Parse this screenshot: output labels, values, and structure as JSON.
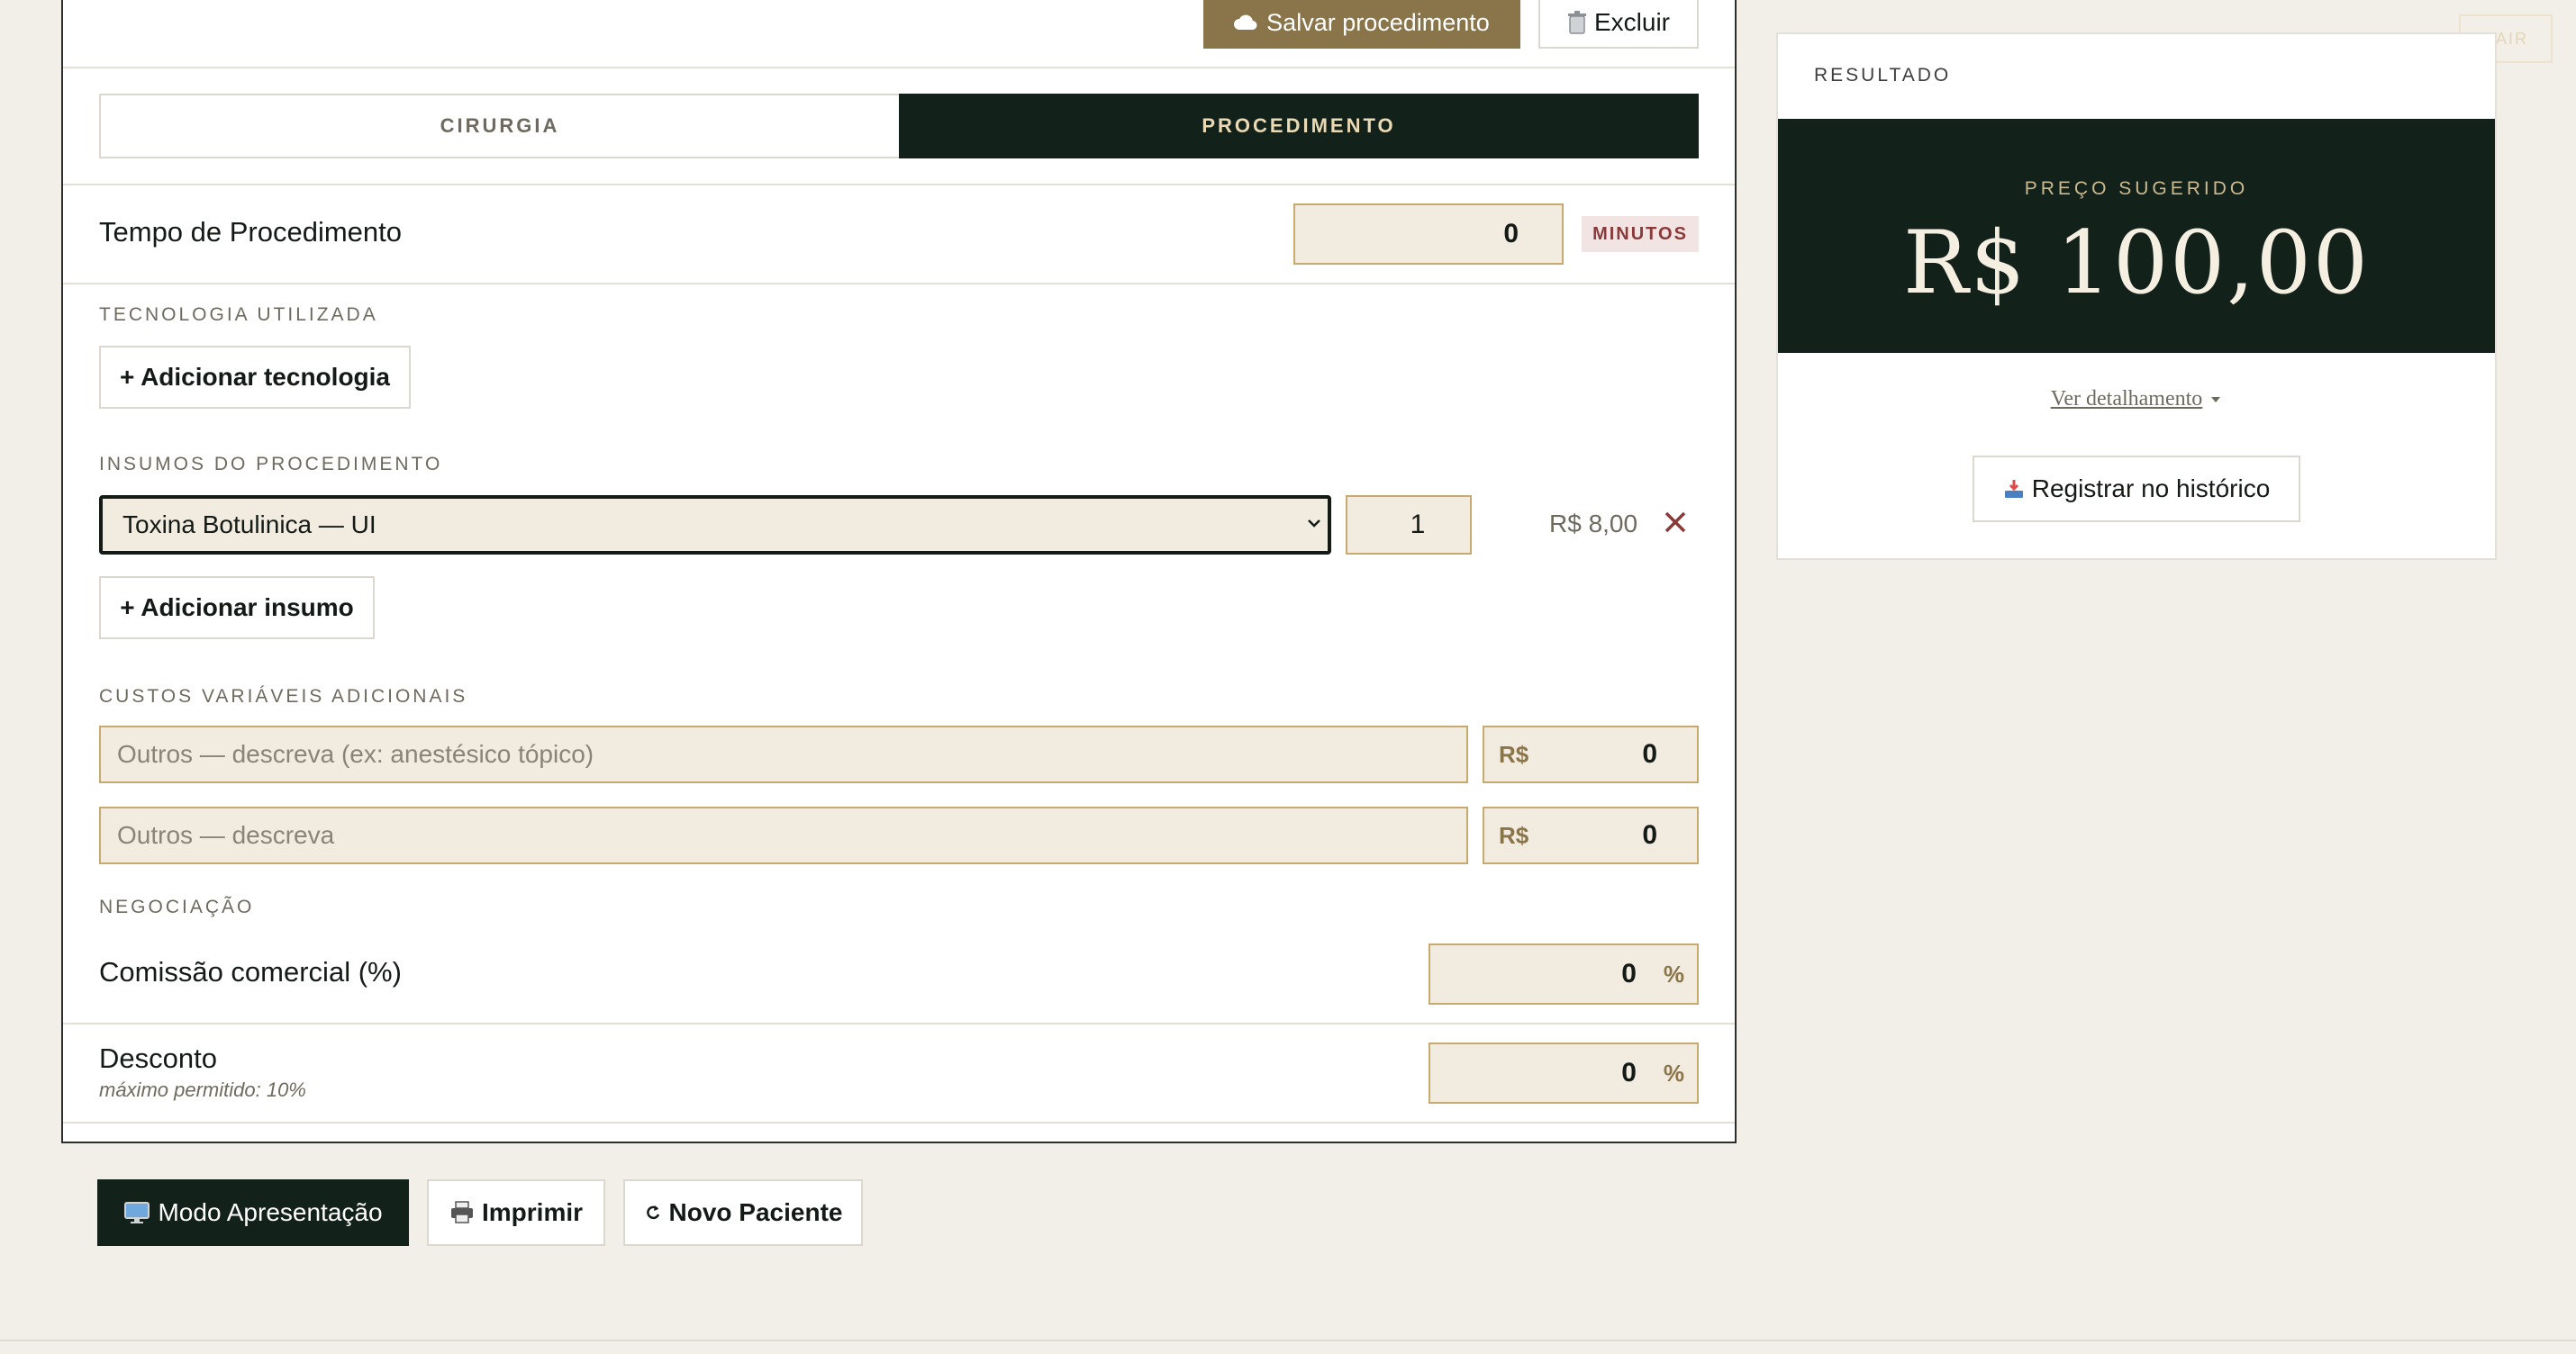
{
  "header": {
    "save_label": "Salvar procedimento",
    "delete_label": "Excluir",
    "logout_label": "SAIR"
  },
  "tabs": [
    {
      "label": "CIRURGIA",
      "active": false
    },
    {
      "label": "PROCEDIMENTO",
      "active": true
    }
  ],
  "tempo": {
    "label": "Tempo de Procedimento",
    "value": "0",
    "unit": "MINUTOS"
  },
  "tecnologia": {
    "section_title": "TECNOLOGIA UTILIZADA",
    "add_label": "+ Adicionar tecnologia"
  },
  "insumos": {
    "section_title": "INSUMOS DO PROCEDIMENTO",
    "items": [
      {
        "selected": "Toxina Botulinica — UI",
        "quantity": "1",
        "price": "R$ 8,00"
      }
    ],
    "add_label": "+ Adicionar insumo"
  },
  "custos": {
    "section_title": "CUSTOS VARIÁVEIS ADICIONAIS",
    "rows": [
      {
        "placeholder": "Outros — descreva (ex: anestésico tópico)",
        "currency": "R$",
        "value": "0"
      },
      {
        "placeholder": "Outros — descreva",
        "currency": "R$",
        "value": "0"
      }
    ]
  },
  "negociacao": {
    "section_title": "NEGOCIAÇÃO",
    "comissao_label": "Comissão comercial (%)",
    "comissao_value": "0",
    "desconto_label": "Desconto",
    "desconto_hint": "máximo permitido: 10%",
    "desconto_value": "0",
    "percent_symbol": "%"
  },
  "actions": {
    "presentation_label": "Modo Apresentação",
    "print_label": "Imprimir",
    "new_patient_label": "Novo Paciente"
  },
  "resultado": {
    "title": "RESULTADO",
    "price_label": "PREÇO SUGERIDO",
    "price_value": "R$ 100,00",
    "details_link": "Ver detalhamento",
    "register_label": "Registrar no histórico"
  },
  "colors": {
    "accent_gold": "#8a7449",
    "dark_green": "#13211b",
    "field_bg": "#f2ebe0",
    "field_border": "#c8a96e",
    "remove_red": "#8b3a3a",
    "background": "#f2efe8"
  },
  "icons": {
    "save": "cloud-icon",
    "delete": "trash-icon",
    "remove_item": "close-icon",
    "details": "caret-down-icon",
    "register": "inbox-tray-icon",
    "presentation": "monitor-icon",
    "print": "printer-icon",
    "new_patient": "refresh-icon"
  }
}
